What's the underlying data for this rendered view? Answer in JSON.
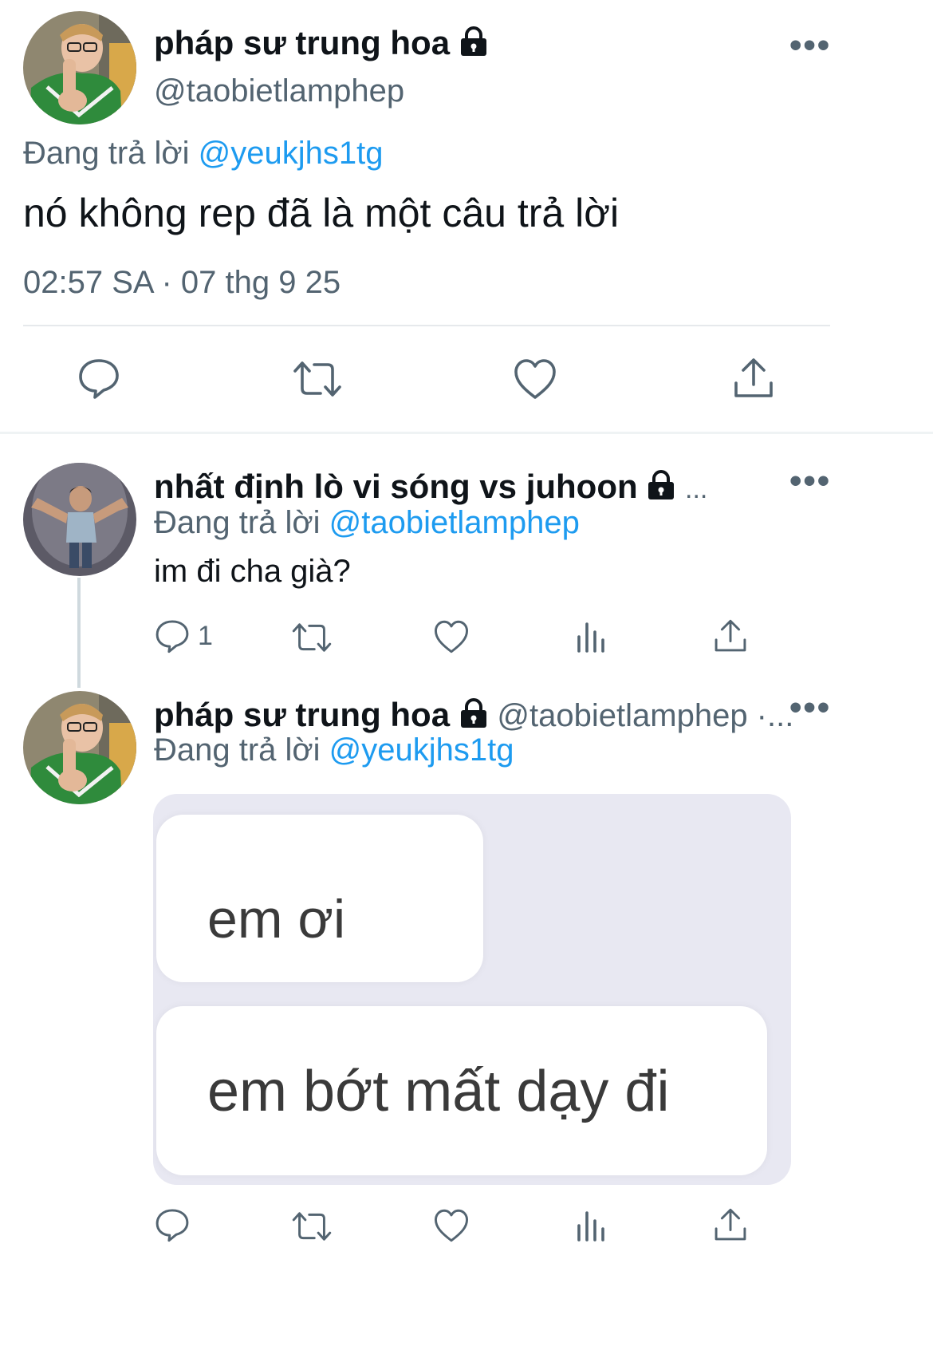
{
  "main_tweet": {
    "display_name": "pháp sư trung hoa",
    "handle": "@taobietlamphep",
    "replying_prefix": "Đang trả lời",
    "replying_to": "@yeukjhs1tg",
    "text": "nó không rep đã là một câu trả lời",
    "timestamp": "02:57 SA · 07 thg 9 25"
  },
  "reply_1": {
    "display_name": "nhất định lò vi sóng vs juhoon",
    "ellipsis": "...",
    "replying_prefix": "Đang trả lời",
    "replying_to": "@taobietlamphep",
    "text": "im đi cha già?",
    "reply_count": "1"
  },
  "reply_2": {
    "display_name": "pháp sư trung hoa",
    "handle_meta": "@taobietlamphep ·...",
    "replying_prefix": "Đang trả lời",
    "replying_to": "@yeukjhs1tg",
    "media": {
      "bubble_1": "em ơi",
      "bubble_2": "em bớt mất dạy đi"
    }
  },
  "colors": {
    "accent": "#1d9bf0",
    "secondary_text": "#536471",
    "divider": "#e6e9ec",
    "media_bg": "#e8e8f2"
  }
}
